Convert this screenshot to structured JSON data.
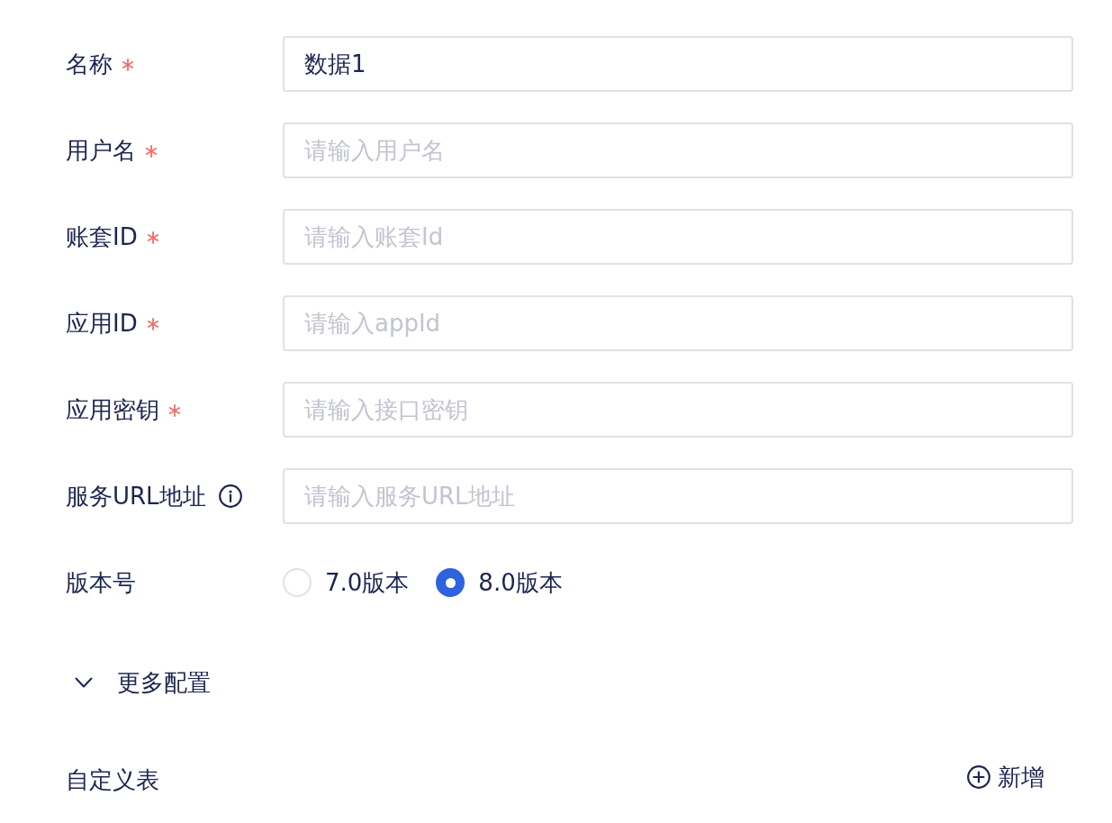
{
  "form": {
    "fields": [
      {
        "label": "名称",
        "required": true,
        "info": false,
        "value": "数据1"
      },
      {
        "label": "用户名",
        "required": true,
        "info": false,
        "placeholder": "请输入用户名"
      },
      {
        "label": "账套ID",
        "required": true,
        "info": false,
        "placeholder": "请输入账套Id"
      },
      {
        "label": "应用ID",
        "required": true,
        "info": false,
        "placeholder": "请输入appId"
      },
      {
        "label": "应用密钥",
        "required": true,
        "info": false,
        "placeholder": "请输入接口密钥"
      },
      {
        "label": "服务URL地址",
        "required": false,
        "info": true,
        "placeholder": "请输入服务URL地址"
      }
    ],
    "version": {
      "label": "版本号",
      "options": [
        {
          "label": "7.0版本",
          "selected": false
        },
        {
          "label": "8.0版本",
          "selected": true
        }
      ]
    },
    "more_config": {
      "label": "更多配置",
      "expanded": true
    }
  },
  "custom_table": {
    "title": "自定义表",
    "add_button": "新增"
  }
}
